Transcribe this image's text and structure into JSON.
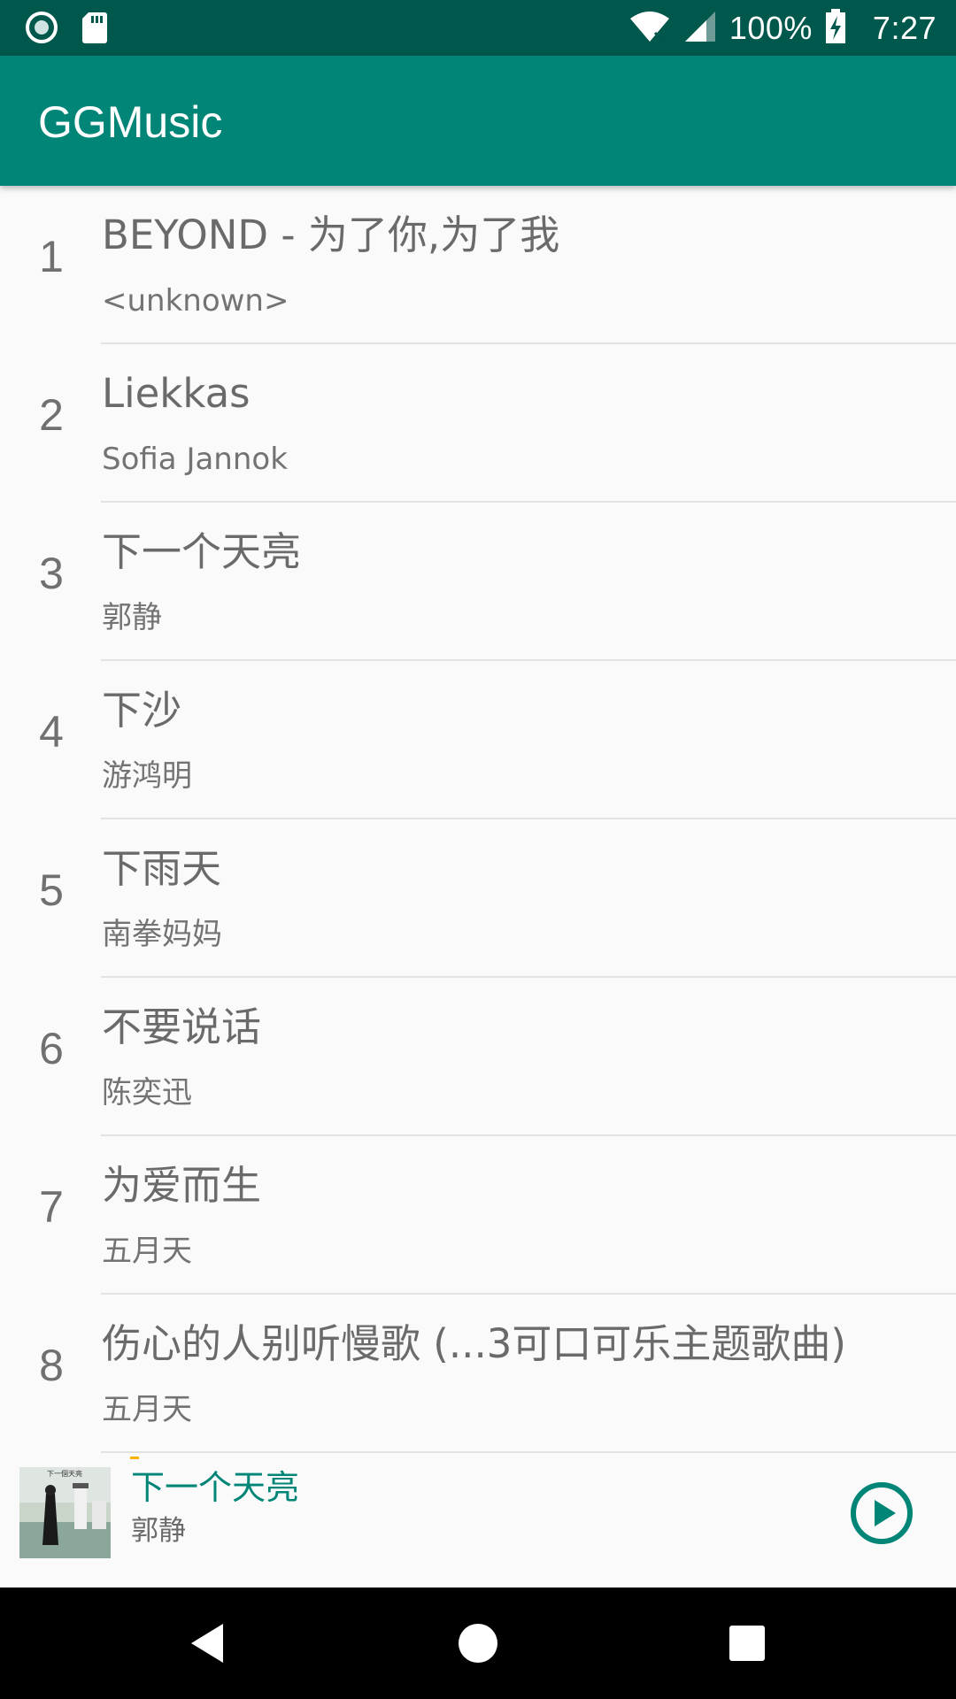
{
  "status_bar": {
    "battery": "100%",
    "time": "7:27"
  },
  "app_bar": {
    "title": "GGMusic"
  },
  "songs": [
    {
      "index": "1",
      "title": "BEYOND - 为了你,为了我",
      "artist": "<unknown>"
    },
    {
      "index": "2",
      "title": "Liekkas",
      "artist": "Sofia Jannok"
    },
    {
      "index": "3",
      "title": "下一个天亮",
      "artist": "郭静"
    },
    {
      "index": "4",
      "title": "下沙",
      "artist": "游鸿明"
    },
    {
      "index": "5",
      "title": "下雨天",
      "artist": "南拳妈妈"
    },
    {
      "index": "6",
      "title": "不要说话",
      "artist": "陈奕迅"
    },
    {
      "index": "7",
      "title": "为爱而生",
      "artist": "五月天"
    },
    {
      "index": "8",
      "title": "伤心的人别听慢歌 (...3可口可乐主题歌曲)",
      "artist": "五月天"
    }
  ],
  "player": {
    "title": "下一个天亮",
    "artist": "郭静",
    "album_art_text": "下一個天亮"
  },
  "colors": {
    "status_bar": "#00574b",
    "primary": "#008577",
    "accent": "#ffb300"
  }
}
